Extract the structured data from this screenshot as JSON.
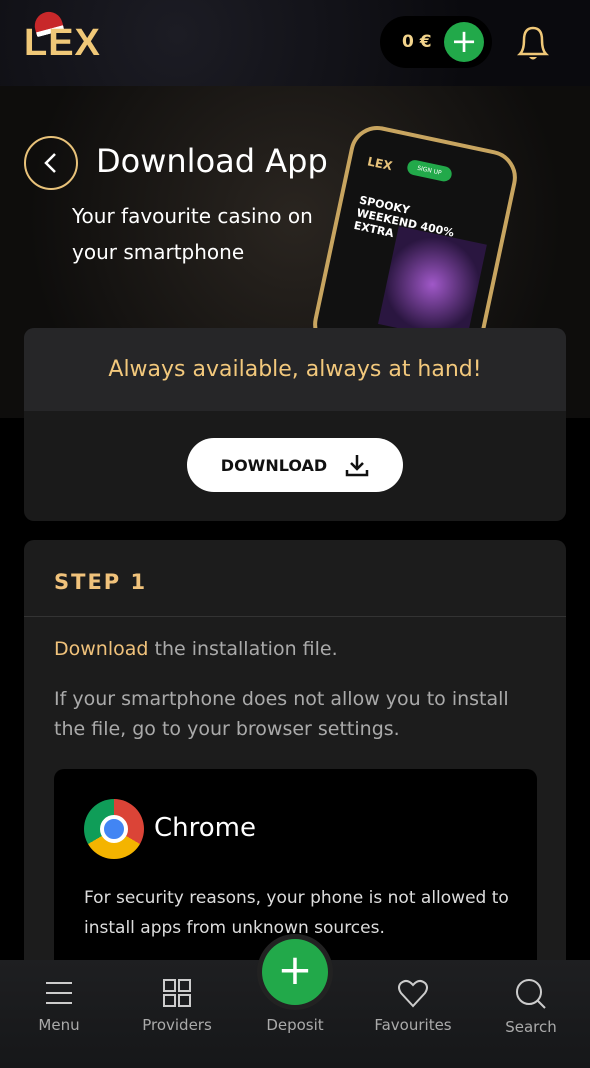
{
  "header": {
    "logo": "LEX",
    "balance": "0 €",
    "bell": "bell-icon"
  },
  "hero": {
    "title": "Download App",
    "subtitle": "Your favourite casino on your smartphone",
    "phone": {
      "logo": "LEX",
      "signup": "SIGN UP",
      "promo": "SPOOKY WEEKEND 400% EXTRA"
    }
  },
  "promo": {
    "tagline": "Always available, always at hand!",
    "download_label": "DOWNLOAD"
  },
  "step": {
    "title": "STEP 1",
    "line1_highlight": "Download",
    "line1_rest": " the installation file.",
    "line2": "If your smartphone does not allow you to install the file, go to your browser settings.",
    "browser": {
      "name": "Chrome",
      "text": "For security reasons, your phone is not allowed to install apps from unknown sources."
    }
  },
  "nav": {
    "menu": "Menu",
    "providers": "Providers",
    "deposit": "Deposit",
    "favourites": "Favourites",
    "search": "Search"
  },
  "colors": {
    "gold": "#f0c27b",
    "green": "#22a94a"
  }
}
